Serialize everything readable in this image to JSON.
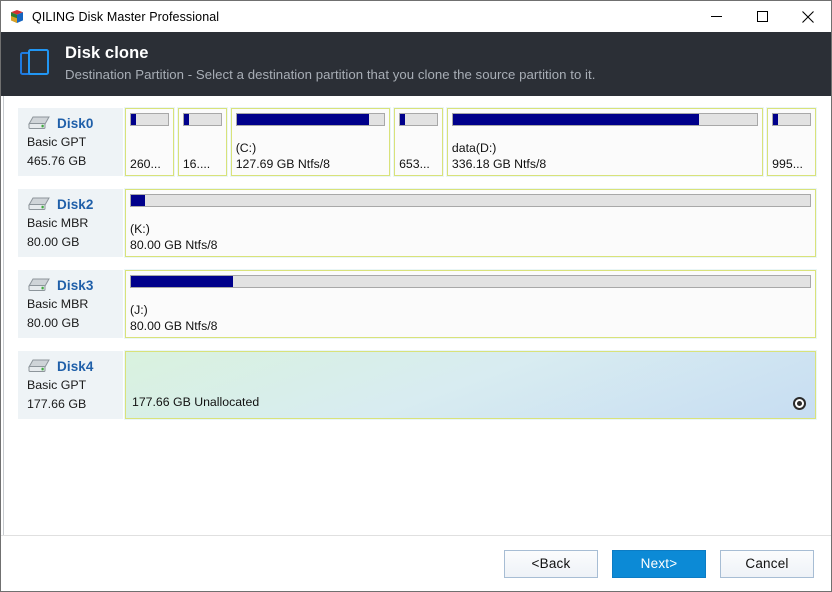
{
  "window": {
    "title": "QILING Disk Master Professional",
    "app_icon": "cube-icon",
    "controls": [
      {
        "name": "minimize",
        "glyph": "—"
      },
      {
        "name": "maximize",
        "glyph": "□"
      },
      {
        "name": "close",
        "glyph": "✕"
      }
    ]
  },
  "header": {
    "icon": "clone-icon",
    "title": "Disk clone",
    "subtitle": "Destination Partition - Select a destination partition that you clone the source partition to it."
  },
  "disks": [
    {
      "name": "Disk0",
      "type": "Basic GPT",
      "capacity": "465.76 GB",
      "icon": "hard-drive-icon",
      "partitions": [
        {
          "volume": "",
          "size": "260...",
          "used_pct": 14,
          "flex": 26,
          "selected": false,
          "unallocated": false
        },
        {
          "volume": "",
          "size": "16....",
          "used_pct": 14,
          "flex": 26,
          "selected": false,
          "unallocated": false
        },
        {
          "volume": "(C:)",
          "size": "127.69 GB Ntfs/8",
          "used_pct": 90,
          "flex": 100,
          "selected": false,
          "unallocated": false
        },
        {
          "volume": "",
          "size": "653...",
          "used_pct": 14,
          "flex": 26,
          "selected": false,
          "unallocated": false
        },
        {
          "volume": "data(D:)",
          "size": "336.18 GB Ntfs/8",
          "used_pct": 81,
          "flex": 205,
          "selected": false,
          "unallocated": false
        },
        {
          "volume": "",
          "size": "995...",
          "used_pct": 14,
          "flex": 26,
          "selected": false,
          "unallocated": false
        }
      ]
    },
    {
      "name": "Disk2",
      "type": "Basic MBR",
      "capacity": "80.00 GB",
      "icon": "hard-drive-icon",
      "partitions": [
        {
          "volume": "(K:)",
          "size": "80.00 GB Ntfs/8",
          "used_pct": 2,
          "flex": 100,
          "selected": false,
          "unallocated": false
        }
      ]
    },
    {
      "name": "Disk3",
      "type": "Basic MBR",
      "capacity": "80.00 GB",
      "icon": "hard-drive-icon",
      "partitions": [
        {
          "volume": "(J:)",
          "size": "80.00 GB Ntfs/8",
          "used_pct": 15,
          "flex": 100,
          "selected": false,
          "unallocated": false
        }
      ]
    },
    {
      "name": "Disk4",
      "type": "Basic GPT",
      "capacity": "177.66 GB",
      "icon": "hard-drive-icon",
      "partitions": [
        {
          "volume": "",
          "size": "177.66 GB Unallocated",
          "used_pct": 0,
          "flex": 100,
          "selected": true,
          "unallocated": true
        }
      ]
    }
  ],
  "footer": {
    "back_label": "<Back",
    "next_label": "Next>",
    "cancel_label": "Cancel"
  },
  "colors": {
    "header_bg": "#2b2f36",
    "accent_blue": "#0c8ad6",
    "disk_name": "#1f5fa9",
    "partition_border": "#d9e27a",
    "usage_fill": "#00008b",
    "unallocated_start": "#d9f2de",
    "unallocated_end": "#c7ddf2"
  }
}
